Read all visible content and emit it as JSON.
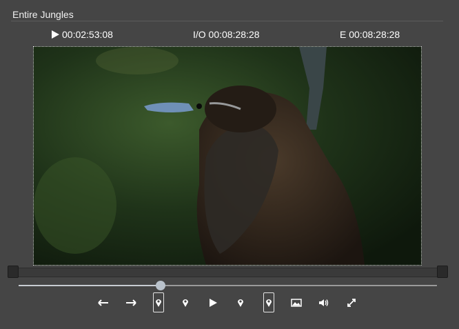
{
  "window": {
    "title": "Entire Jungles"
  },
  "timecodes": {
    "current": "00:02:53:08",
    "io": "I/O 00:08:28:28",
    "end": "E 00:08:28:28"
  },
  "playback": {
    "progress_fraction": 0.34
  },
  "controls": [
    {
      "icon": "arrow-left-icon",
      "boxed": false
    },
    {
      "icon": "arrow-right-icon",
      "boxed": false
    },
    {
      "icon": "marker-in-icon",
      "boxed": true
    },
    {
      "icon": "marker-icon",
      "boxed": false
    },
    {
      "icon": "play-icon",
      "boxed": false
    },
    {
      "icon": "marker-icon",
      "boxed": false
    },
    {
      "icon": "marker-out-icon",
      "boxed": true
    },
    {
      "icon": "image-icon",
      "boxed": false
    },
    {
      "icon": "volume-icon",
      "boxed": false
    },
    {
      "icon": "fullscreen-icon",
      "boxed": false
    }
  ],
  "colors": {
    "background": "#454545",
    "text": "#ffffff",
    "accent": "#b9c2cb"
  }
}
